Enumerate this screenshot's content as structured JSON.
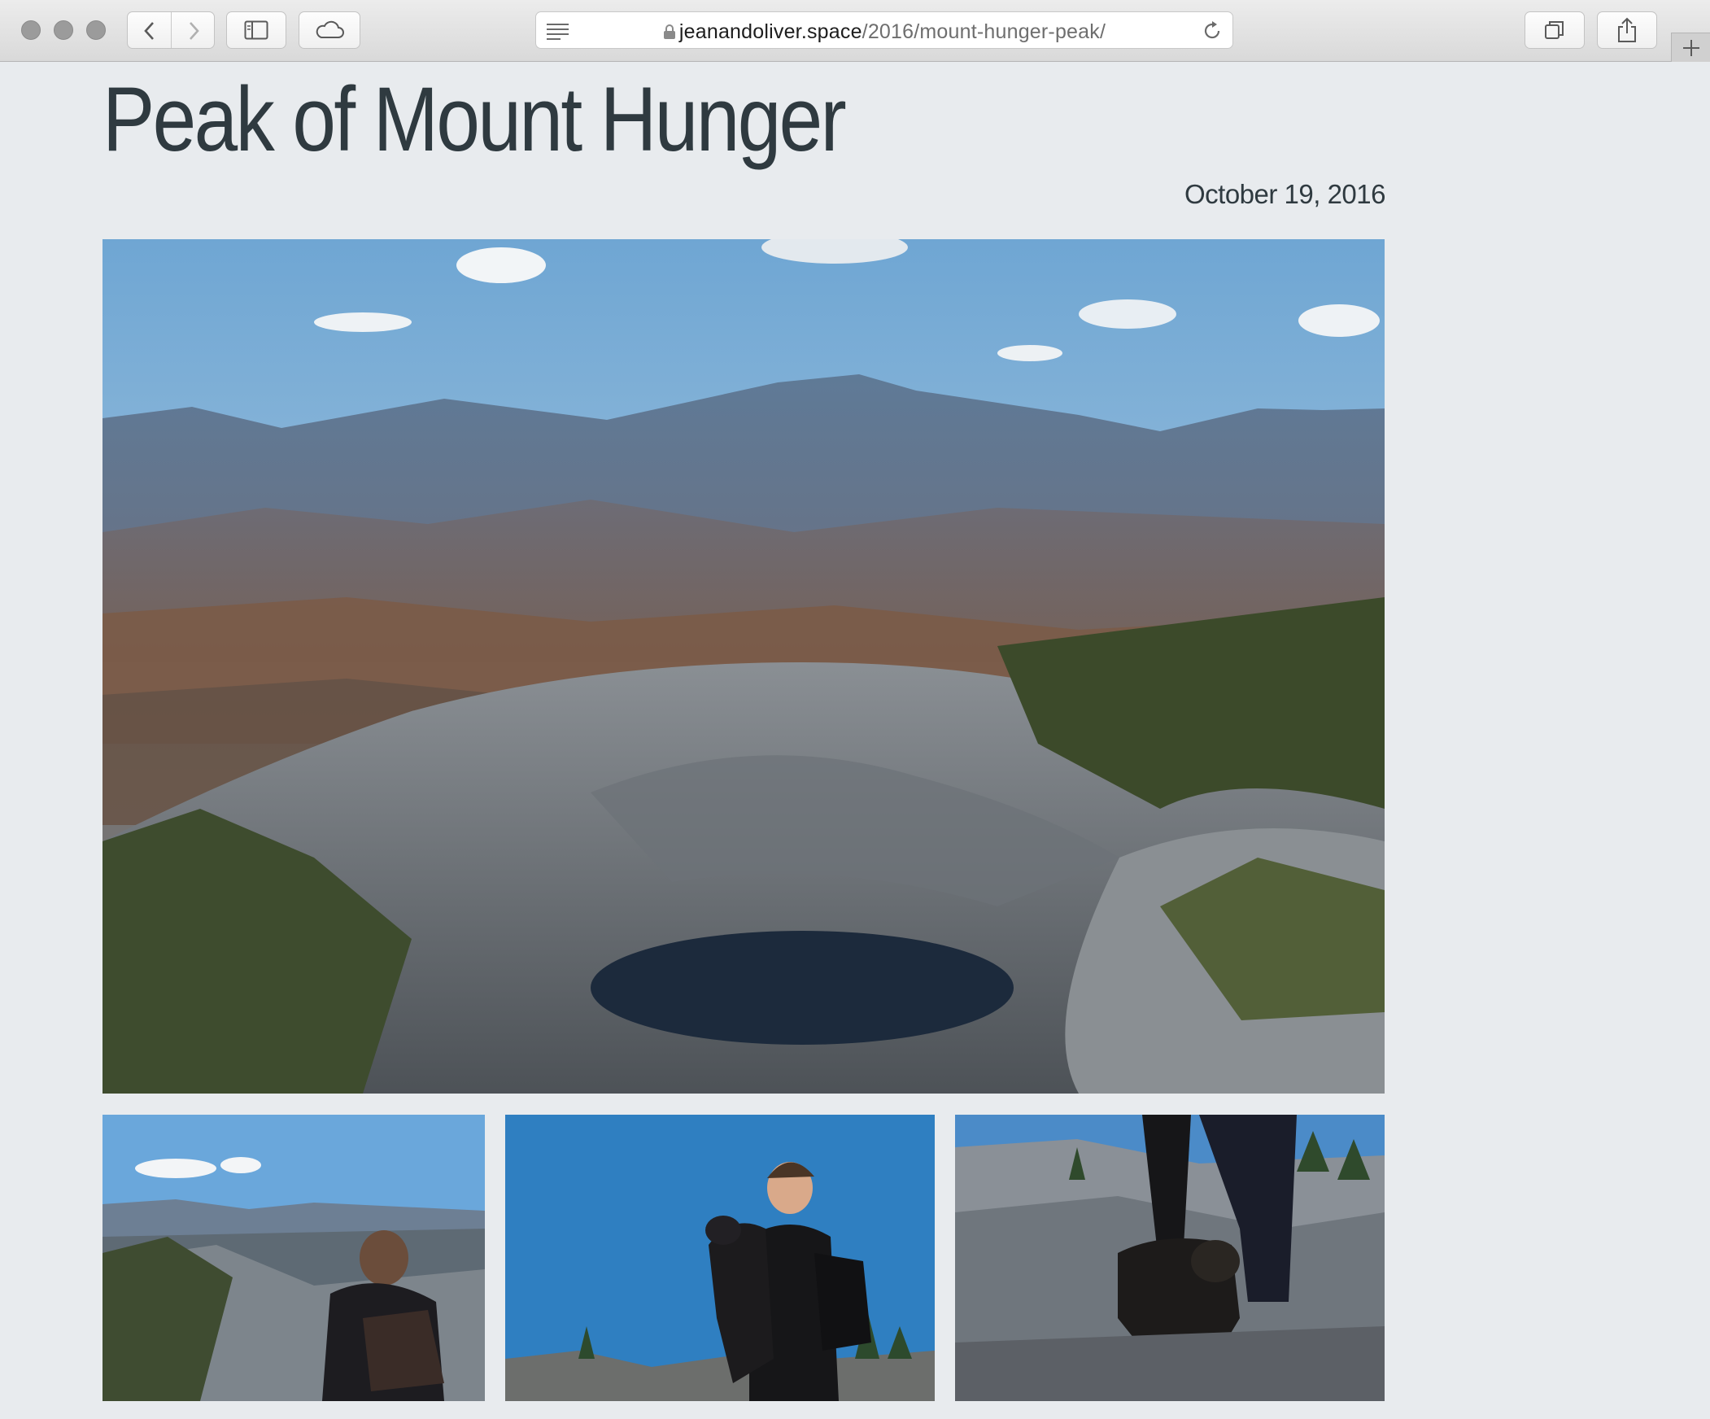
{
  "browser": {
    "url_host": "jeanandoliver.space",
    "url_path": "/2016/mount-hunger-peak/"
  },
  "post": {
    "title": "Peak of Mount Hunger",
    "date": "October 19, 2016"
  },
  "photos": {
    "hero": "mountain-vista",
    "thumbs": [
      "person-crouching-on-rocks",
      "person-holding-dog",
      "dog-on-summit-rocks"
    ]
  },
  "colors": {
    "page_bg": "#e8ebee",
    "text": "#2f3a40",
    "sky": "#8fbbd8"
  }
}
